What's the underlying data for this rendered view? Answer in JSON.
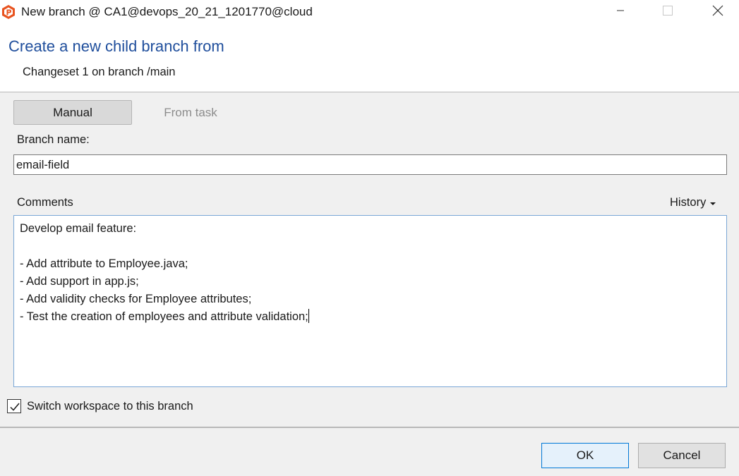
{
  "window": {
    "title": "New branch @ CA1@devops_20_21_1201770@cloud",
    "icon": "plastic-scm-logo-icon",
    "controls": [
      "minimize-icon",
      "maximize-icon",
      "close-icon"
    ]
  },
  "header": {
    "title": "Create a new child branch from",
    "subtitle": "Changeset 1 on branch /main"
  },
  "tabs": [
    {
      "label": "Manual",
      "selected": true
    },
    {
      "label": "From task",
      "selected": false
    }
  ],
  "branch": {
    "label": "Branch name:",
    "value": "email-field"
  },
  "comments": {
    "label": "Comments",
    "history_label": "History",
    "lines": [
      "Develop email feature:",
      "",
      "- Add attribute to Employee.java;",
      "- Add support in app.js;",
      "- Add validity checks for Employee attributes;",
      "- Test the creation of employees and attribute validation;"
    ]
  },
  "switch_workspace": {
    "label": "Switch workspace to this branch",
    "checked": true
  },
  "buttons": {
    "ok": "OK",
    "cancel": "Cancel"
  },
  "colors": {
    "accent": "#1f4e9c",
    "logo": "#e8531f",
    "ok_border": "#0078d7"
  }
}
